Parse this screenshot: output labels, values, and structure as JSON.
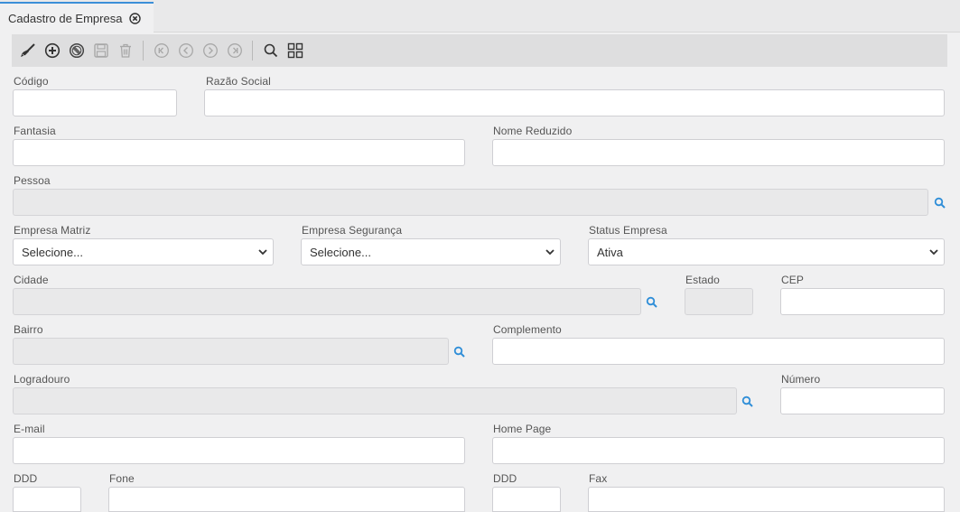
{
  "tab": {
    "title": "Cadastro de Empresa"
  },
  "toolbar": {
    "icons": [
      "broom-icon",
      "add-circle-icon",
      "cancel-circle-icon",
      "save-icon",
      "trash-icon",
      "first-record-icon",
      "previous-record-icon",
      "next-record-icon",
      "last-record-icon",
      "search-icon",
      "grid-view-icon"
    ]
  },
  "form": {
    "codigo": {
      "label": "Código",
      "value": ""
    },
    "razao_social": {
      "label": "Razão Social",
      "value": ""
    },
    "fantasia": {
      "label": "Fantasia",
      "value": ""
    },
    "nome_reduzido": {
      "label": "Nome Reduzido",
      "value": ""
    },
    "pessoa": {
      "label": "Pessoa",
      "value": ""
    },
    "empresa_matriz": {
      "label": "Empresa Matriz",
      "selected": "Selecione..."
    },
    "empresa_seguranca": {
      "label": "Empresa Segurança",
      "selected": "Selecione..."
    },
    "status_empresa": {
      "label": "Status Empresa",
      "selected": "Ativa"
    },
    "cidade": {
      "label": "Cidade",
      "value": ""
    },
    "estado": {
      "label": "Estado",
      "value": ""
    },
    "cep": {
      "label": "CEP",
      "value": ""
    },
    "bairro": {
      "label": "Bairro",
      "value": ""
    },
    "complemento": {
      "label": "Complemento",
      "value": ""
    },
    "logradouro": {
      "label": "Logradouro",
      "value": ""
    },
    "numero": {
      "label": "Número",
      "value": ""
    },
    "email": {
      "label": "E-mail",
      "value": ""
    },
    "home_page": {
      "label": "Home Page",
      "value": ""
    },
    "ddd_fone": {
      "label": "DDD",
      "value": ""
    },
    "fone": {
      "label": "Fone",
      "value": ""
    },
    "ddd_fax": {
      "label": "DDD",
      "value": ""
    },
    "fax": {
      "label": "Fax",
      "value": ""
    }
  },
  "colors": {
    "accent": "#3b8fd8",
    "lookup": "#2f8ed8",
    "toolbar_icon": "#444444",
    "toolbar_icon_disabled": "#a8a8a8"
  }
}
